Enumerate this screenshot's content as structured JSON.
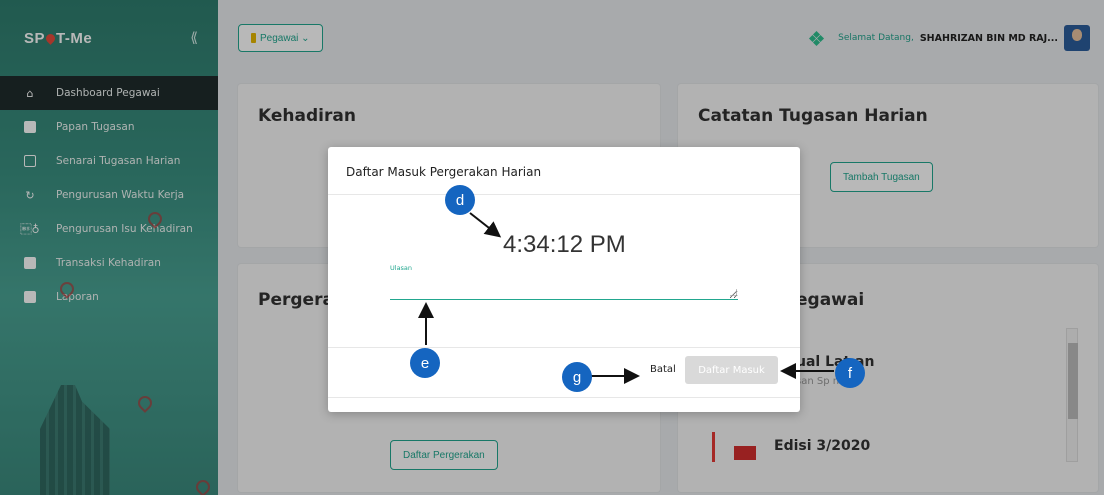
{
  "app": {
    "logo": "SP T-Me",
    "welcome_prefix": "Selamat Datang,",
    "user_name": "SHAHRIZAN BIN MD RAJ..."
  },
  "topbar": {
    "role_label": "Pegawai ⌄"
  },
  "sidebar": {
    "items": [
      {
        "label": "Dashboard Pegawai",
        "icon": "home-icon"
      },
      {
        "label": "Papan Tugasan",
        "icon": "pin-board-icon"
      },
      {
        "label": "Senarai Tugasan Harian",
        "icon": "task-list-icon"
      },
      {
        "label": "Pengurusan Waktu Kerja",
        "icon": "history-icon"
      },
      {
        "label": "Pengurusan Isu Kehadiran",
        "icon": "person-icon"
      },
      {
        "label": "Transaksi Kehadiran",
        "icon": "table-icon"
      },
      {
        "label": "Laporan",
        "icon": "report-icon"
      }
    ]
  },
  "cards": {
    "kehadiran": {
      "title": "Kehadiran"
    },
    "catatan": {
      "title": "Catatan Tugasan Harian",
      "button": "Tambah Tugasan"
    },
    "pergerakan": {
      "title": "Pergera",
      "button": "Daftar Pergerakan"
    },
    "pegawai": {
      "title": "egawai",
      "item1_title": "ual Lat an",
      "item1_sub": "san Sp ne",
      "item2_title": "Edisi 3/2020"
    }
  },
  "modal": {
    "title": "Daftar Masuk Pergerakan Harian",
    "clock": "4:34:12 PM",
    "field_label": "Ulasan",
    "field_value": "",
    "cancel": "Batal",
    "submit": "Daftar Masuk"
  },
  "annotations": {
    "d": "d",
    "e": "e",
    "f": "f",
    "g": "g"
  },
  "colors": {
    "accent": "#22a78f",
    "sidebar": "#3a8f80",
    "badge": "#1565c0",
    "disabled": "#d9d9d9"
  }
}
